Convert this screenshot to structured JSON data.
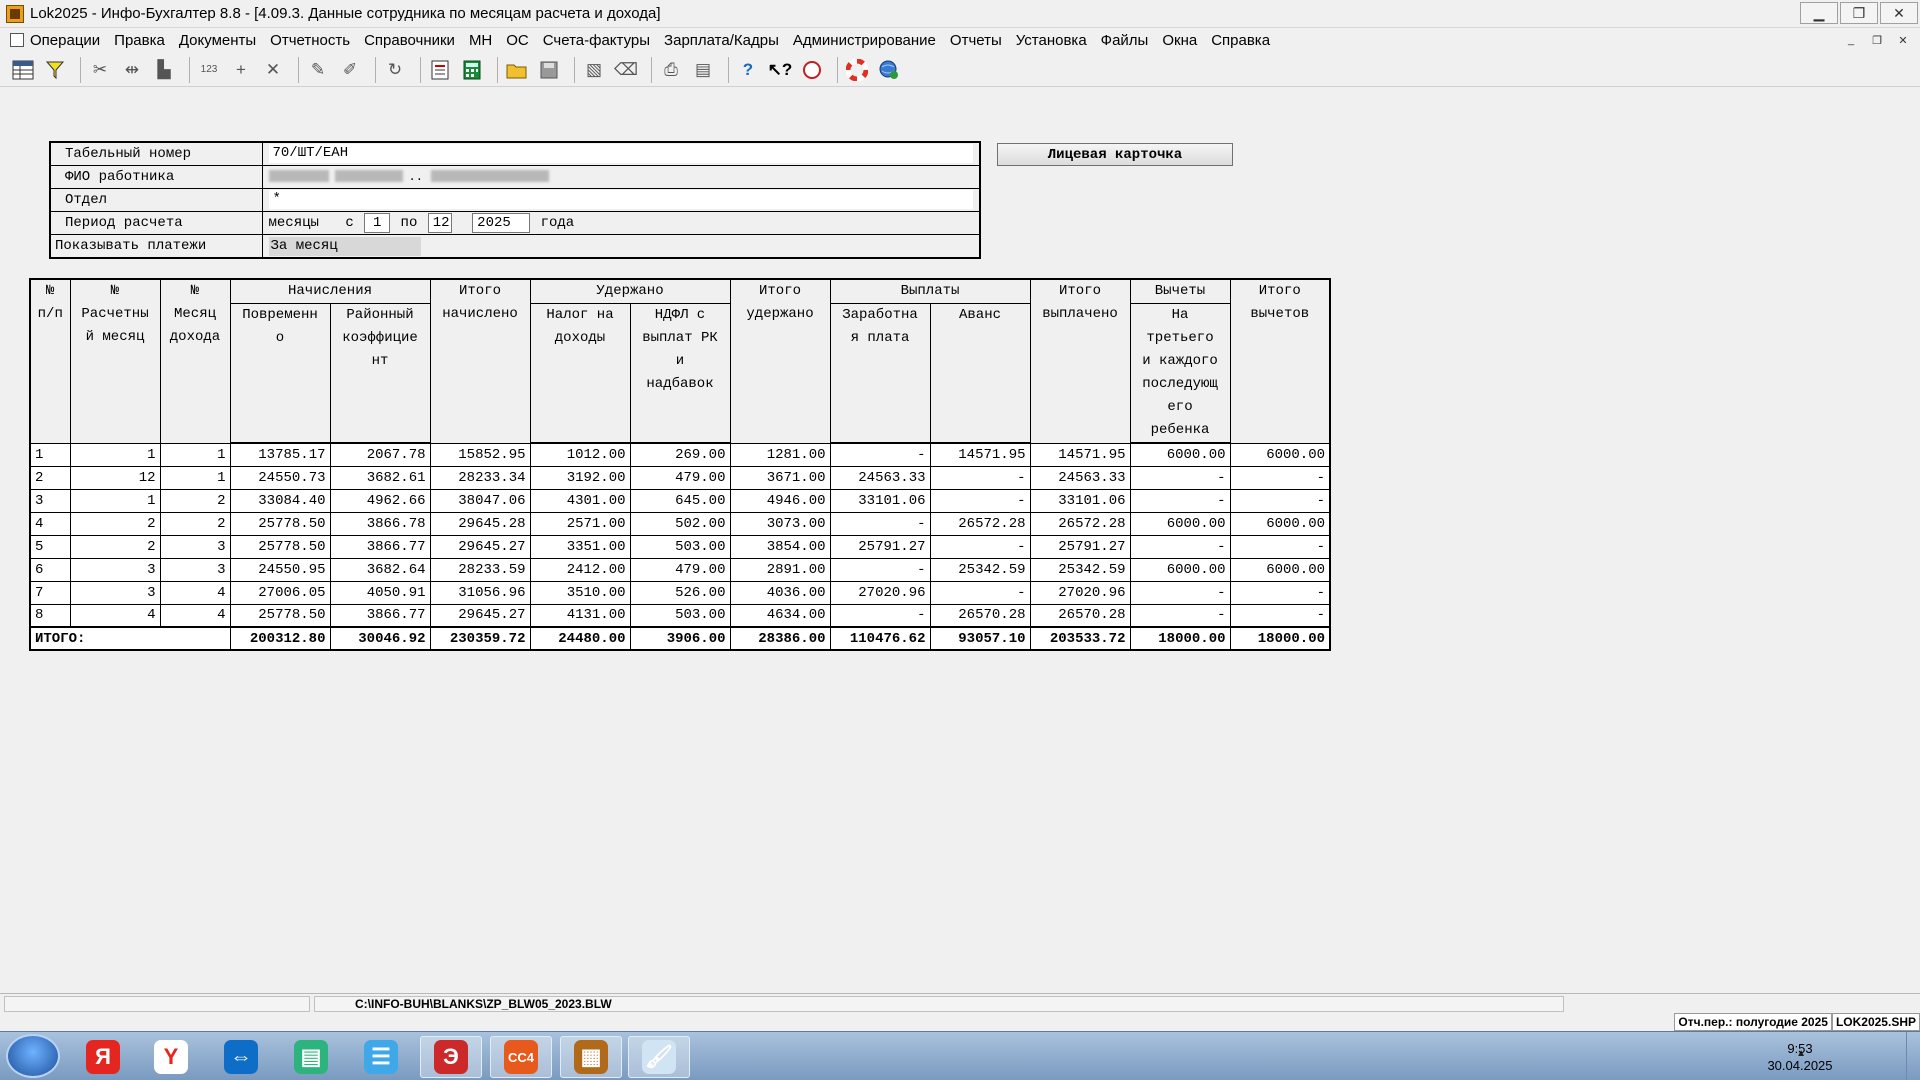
{
  "window": {
    "title": "Lok2025 - Инфо-Бухгалтер 8.8 - [4.09.3. Данные сотрудника по месяцам расчета и дохода]",
    "minimize": "▁",
    "maximize": "❐",
    "close": "✕"
  },
  "menu": [
    "Операции",
    "Правка",
    "Документы",
    "Отчетность",
    "Справочники",
    "МН",
    "ОС",
    "Счета-фактуры",
    "Зарплата/Кадры",
    "Администрирование",
    "Отчеты",
    "Установка",
    "Файлы",
    "Окна",
    "Справка"
  ],
  "mdi": {
    "minimize": "_",
    "restore": "❐",
    "close": "✕"
  },
  "toolbar_icons": [
    "grid-icon",
    "filter-icon",
    "sep",
    "cut-icon",
    "move-icon",
    "paste-icon",
    "sep",
    "numbering-icon",
    "add-icon",
    "delete-icon",
    "sep",
    "mark-icon",
    "unmark-icon",
    "sep",
    "refresh-icon",
    "sep",
    "report-icon",
    "calculator-icon",
    "sep",
    "open-folder-icon",
    "save-icon",
    "sep",
    "preview-icon",
    "erase-icon",
    "sep",
    "print-icon",
    "page-setup-icon",
    "sep",
    "help-icon",
    "context-help-icon",
    "compass-icon",
    "sep",
    "lifebuoy-icon",
    "web-icon"
  ],
  "form": {
    "tab_label": "Табельный номер",
    "tab_value": "70/ШТ/ЕАН",
    "fio_label": "ФИО работника",
    "fio_dots": "..",
    "dept_label": "Отдел",
    "dept_value": "*",
    "period_label": "Период расчета",
    "period_months": "месяцы",
    "period_from_label": "с",
    "period_from": "1",
    "period_to_label": "по",
    "period_to": "12",
    "period_year": "2025",
    "period_year_label": "года",
    "payments_label": "Показывать платежи",
    "payments_value": "За месяц"
  },
  "card_button": "Лицевая карточка",
  "table": {
    "headers": {
      "num": [
        "№",
        "п/п"
      ],
      "calc_month": [
        "№",
        "Расчетны",
        "й месяц"
      ],
      "income_month": [
        "№",
        "Месяц",
        "дохода"
      ],
      "accruals": "Начисления",
      "time": [
        "Повременн",
        "о"
      ],
      "regional": [
        "Районный",
        "коэффицие",
        "нт"
      ],
      "total_accrued": [
        "Итого",
        "начислено"
      ],
      "withheld": "Удержано",
      "income_tax": [
        "Налог на",
        "доходы"
      ],
      "ndfl": [
        "НДФЛ с",
        "выплат РК",
        "и",
        "надбавок"
      ],
      "total_withheld": [
        "Итого",
        "удержано"
      ],
      "payouts": "Выплаты",
      "salary": [
        "Заработна",
        "я плата"
      ],
      "advance": [
        "Аванс"
      ],
      "total_paid": [
        "Итого",
        "выплачено"
      ],
      "deductions": "Вычеты",
      "third_child": [
        "На",
        "третьего",
        "и каждого",
        "последующ",
        "его",
        "ребенка"
      ],
      "total_deductions": [
        "Итого",
        "вычетов"
      ]
    },
    "rows": [
      [
        "1",
        "1",
        "1",
        "13785.17",
        "2067.78",
        "15852.95",
        "1012.00",
        "269.00",
        "1281.00",
        "-",
        "14571.95",
        "14571.95",
        "6000.00",
        "6000.00"
      ],
      [
        "2",
        "12",
        "1",
        "24550.73",
        "3682.61",
        "28233.34",
        "3192.00",
        "479.00",
        "3671.00",
        "24563.33",
        "-",
        "24563.33",
        "-",
        "-"
      ],
      [
        "3",
        "1",
        "2",
        "33084.40",
        "4962.66",
        "38047.06",
        "4301.00",
        "645.00",
        "4946.00",
        "33101.06",
        "-",
        "33101.06",
        "-",
        "-"
      ],
      [
        "4",
        "2",
        "2",
        "25778.50",
        "3866.78",
        "29645.28",
        "2571.00",
        "502.00",
        "3073.00",
        "-",
        "26572.28",
        "26572.28",
        "6000.00",
        "6000.00"
      ],
      [
        "5",
        "2",
        "3",
        "25778.50",
        "3866.77",
        "29645.27",
        "3351.00",
        "503.00",
        "3854.00",
        "25791.27",
        "-",
        "25791.27",
        "-",
        "-"
      ],
      [
        "6",
        "3",
        "3",
        "24550.95",
        "3682.64",
        "28233.59",
        "2412.00",
        "479.00",
        "2891.00",
        "-",
        "25342.59",
        "25342.59",
        "6000.00",
        "6000.00"
      ],
      [
        "7",
        "3",
        "4",
        "27006.05",
        "4050.91",
        "31056.96",
        "3510.00",
        "526.00",
        "4036.00",
        "27020.96",
        "-",
        "27020.96",
        "-",
        "-"
      ],
      [
        "8",
        "4",
        "4",
        "25778.50",
        "3866.77",
        "29645.27",
        "4131.00",
        "503.00",
        "4634.00",
        "-",
        "26570.28",
        "26570.28",
        "-",
        "-"
      ]
    ],
    "total_label": "ИТОГО:",
    "totals": [
      "200312.80",
      "30046.92",
      "230359.72",
      "24480.00",
      "3906.00",
      "28386.00",
      "110476.62",
      "93057.10",
      "203533.72",
      "18000.00",
      "18000.00"
    ]
  },
  "statusbar": {
    "path": "C:\\INFO-BUH\\BLANKS\\ZP_BLW05_2023.BLW",
    "report_period": "Отч.пер.: полугодие 2025",
    "file": "LOK2025.SHP"
  },
  "taskbar": {
    "apps": [
      {
        "name": "yandex-icon",
        "glyph": "Я",
        "color": "#e52620"
      },
      {
        "name": "yandex-browser-icon",
        "glyph": "Y",
        "color": "#ffffff"
      },
      {
        "name": "teamviewer-icon",
        "glyph": "⇔",
        "color": "#0e6ec7"
      },
      {
        "name": "chat-app-icon",
        "glyph": "▤",
        "color": "#2db37d"
      },
      {
        "name": "messenger-icon",
        "glyph": "☰",
        "color": "#3ea8e8"
      },
      {
        "name": "opera-icon",
        "glyph": "Э",
        "color": "#cc2a2a"
      },
      {
        "name": "cc4-icon",
        "glyph": "CC4",
        "color": "#e85a1c"
      },
      {
        "name": "abacus-icon",
        "glyph": "▦",
        "color": "#b06a1a"
      },
      {
        "name": "paint-icon",
        "glyph": "🖌",
        "color": "#d0e4f4"
      }
    ],
    "time": "9:53",
    "date": "30.04.2025"
  }
}
